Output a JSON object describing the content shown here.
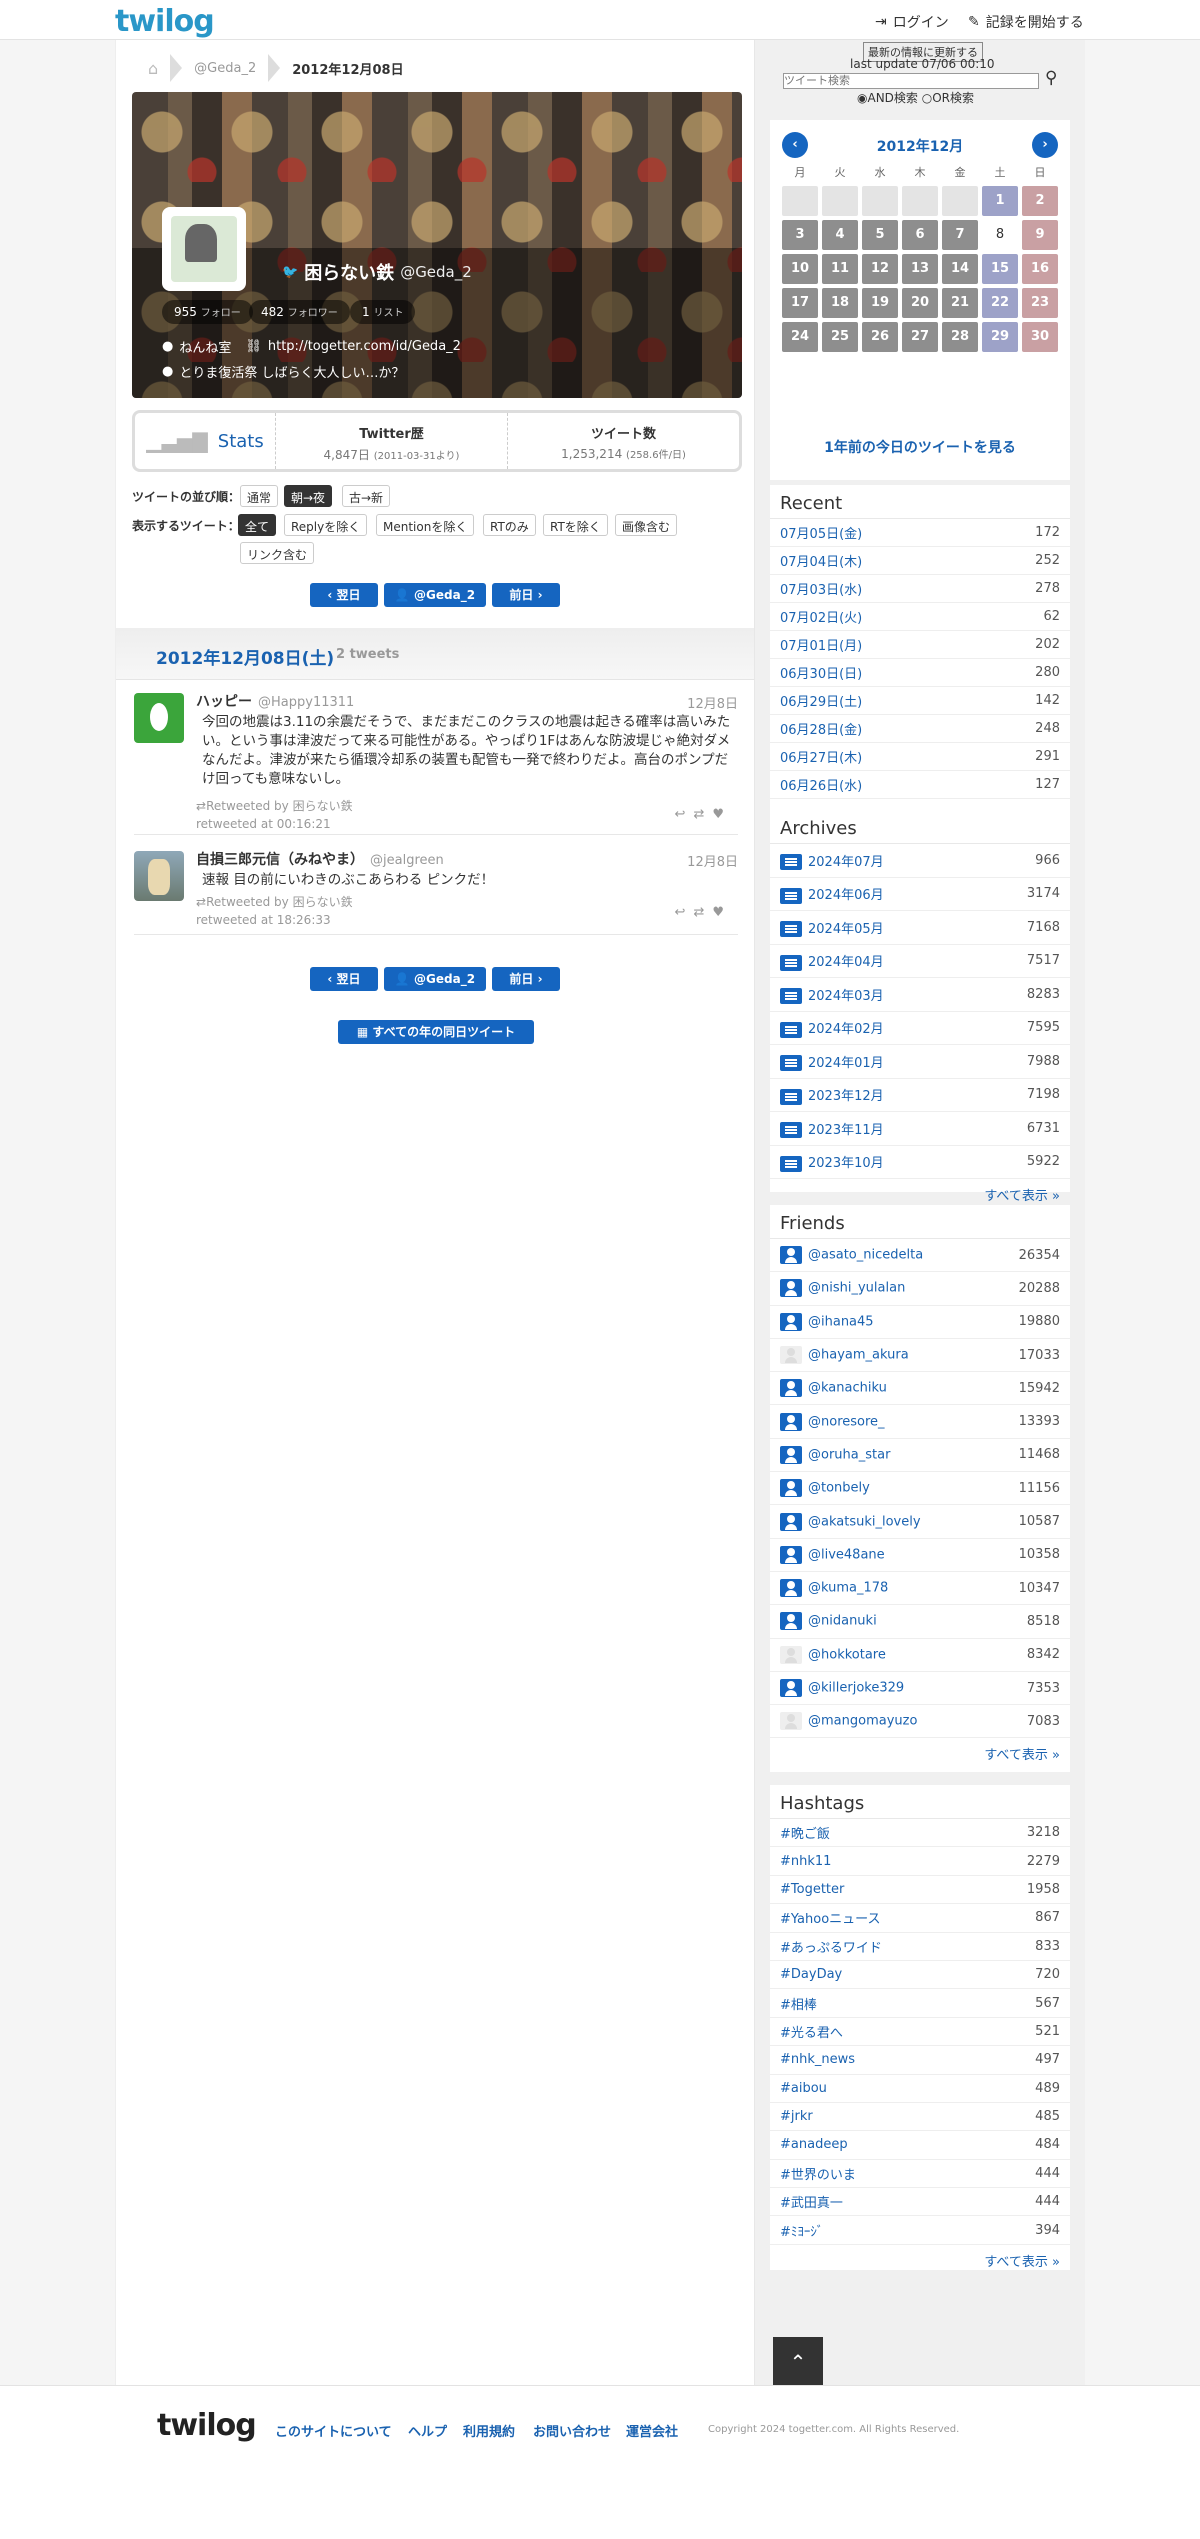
{
  "header": {
    "logo": "twilog",
    "login": "ログイン",
    "start": "記録を開始する"
  },
  "breadcrumb": {
    "user": "@Geda_2",
    "date": "2012年12月08日"
  },
  "profile": {
    "name": "困らない鉄",
    "screen_name": "@Geda_2",
    "follow_count": "955",
    "follow_label": "フォロー",
    "follower_count": "482",
    "follower_label": "フォロワー",
    "list_count": "1",
    "list_label": "リスト",
    "location": "ねんね室",
    "url": "http://togetter.com/id/Geda_2",
    "bio": "とりま復活祭 しばらく大人しい…か？"
  },
  "stats": {
    "label": "Stats",
    "history_title": "Twitter歴",
    "history_value": "4,847日",
    "history_since": "(2011-03-31より)",
    "tweets_title": "ツイート数",
    "tweets_value": "1,253,214",
    "tweets_rate": "(258.6件/日)"
  },
  "controls": {
    "order_label": "ツイートの並び順：",
    "order": [
      "通常",
      "朝→夜",
      "古→新"
    ],
    "filter_label": "表示するツイート：",
    "filters": [
      "全て",
      "Replyを除く",
      "Mentionを除く",
      "RTのみ",
      "RTを除く",
      "画像含む",
      "リンク含む"
    ]
  },
  "nav": {
    "next": "翌日",
    "user": "@Geda_2",
    "prev": "前日",
    "all_years": "すべての年の同日ツイート"
  },
  "day": {
    "date": "2012年12月08日(土)",
    "count": "2 tweets"
  },
  "tweets": [
    {
      "name": "ハッピー",
      "screen": "@Happy11311",
      "date": "12月8日",
      "text": "今回の地震は3.11の余震だそうで、まだまだこのクラスの地震は起きる確率は高いみたい。という事は津波だって来る可能性がある。やっぱり1Fはあんな防波堤じゃ絶対ダメなんだよ。津波が来たら循環冷却系の装置も配管も一発で終わりだよ。高台のポンプだけ回っても意味ないし。",
      "rt_by": "Retweeted by 困らない鉄",
      "rt_at": "retweeted at 00:16:21"
    },
    {
      "name": "自損三郎元信（みねやま）",
      "screen": "@jealgreen",
      "date": "12月8日",
      "text": "速報 目の前にいわきのぶこあらわる ピンクだ！",
      "rt_by": "Retweeted by 困らない鉄",
      "rt_at": "retweeted at 18:26:33"
    }
  ],
  "sidebar": {
    "update_btn": "最新の情報に更新する",
    "last_update": "last update 07/06 00:10",
    "search_placeholder": "ツイート検索",
    "and": "AND検索",
    "or": "OR検索",
    "calendar": {
      "title": "2012年12月",
      "weekdays": [
        "月",
        "火",
        "水",
        "木",
        "金",
        "土",
        "日"
      ],
      "year_ago": "1年前の今日のツイートを見る"
    },
    "recent_title": "Recent",
    "recent": [
      [
        "07月05日(金)",
        "172"
      ],
      [
        "07月04日(木)",
        "252"
      ],
      [
        "07月03日(水)",
        "278"
      ],
      [
        "07月02日(火)",
        "62"
      ],
      [
        "07月01日(月)",
        "202"
      ],
      [
        "06月30日(日)",
        "280"
      ],
      [
        "06月29日(土)",
        "142"
      ],
      [
        "06月28日(金)",
        "248"
      ],
      [
        "06月27日(木)",
        "291"
      ],
      [
        "06月26日(水)",
        "127"
      ]
    ],
    "archives_title": "Archives",
    "archives": [
      [
        "2024年07月",
        "966"
      ],
      [
        "2024年06月",
        "3174"
      ],
      [
        "2024年05月",
        "7168"
      ],
      [
        "2024年04月",
        "7517"
      ],
      [
        "2024年03月",
        "8283"
      ],
      [
        "2024年02月",
        "7595"
      ],
      [
        "2024年01月",
        "7988"
      ],
      [
        "2023年12月",
        "7198"
      ],
      [
        "2023年11月",
        "6731"
      ],
      [
        "2023年10月",
        "5922"
      ]
    ],
    "show_all": "すべて表示 »",
    "friends_title": "Friends",
    "friends": [
      [
        "@asato_nicedelta",
        "26354"
      ],
      [
        "@nishi_yulalan",
        "20288"
      ],
      [
        "@ihana45",
        "19880"
      ],
      [
        "@hayam_akura",
        "17033"
      ],
      [
        "@kanachiku",
        "15942"
      ],
      [
        "@noresore_",
        "13393"
      ],
      [
        "@oruha_star",
        "11468"
      ],
      [
        "@tonbely",
        "11156"
      ],
      [
        "@akatsuki_lovely",
        "10587"
      ],
      [
        "@live48ane",
        "10358"
      ],
      [
        "@kuma_178",
        "10347"
      ],
      [
        "@nidanuki",
        "8518"
      ],
      [
        "@hokkotare",
        "8342"
      ],
      [
        "@killerjoke329",
        "7353"
      ],
      [
        "@mangomayuzo",
        "7083"
      ]
    ],
    "hashtags_title": "Hashtags",
    "hashtags": [
      [
        "#晩ご飯",
        "3218"
      ],
      [
        "#nhk11",
        "2279"
      ],
      [
        "#Togetter",
        "1958"
      ],
      [
        "#Yahooニュース",
        "867"
      ],
      [
        "#あっぷるワイド",
        "833"
      ],
      [
        "#DayDay",
        "720"
      ],
      [
        "#相棒",
        "567"
      ],
      [
        "#光る君へ",
        "521"
      ],
      [
        "#nhk_news",
        "497"
      ],
      [
        "#aibou",
        "489"
      ],
      [
        "#jrkr",
        "485"
      ],
      [
        "#anadeep",
        "484"
      ],
      [
        "#世界のいま",
        "444"
      ],
      [
        "#武田真一",
        "444"
      ],
      [
        "#ﾐﾖｰｼﾞ",
        "394"
      ]
    ]
  },
  "footer": {
    "logo": "twilog",
    "links": [
      "このサイトについて",
      "ヘルプ",
      "利用規約",
      "お問い合わせ",
      "運営会社"
    ],
    "copyright": "Copyright 2024 togetter.com. All Rights Reserved."
  }
}
